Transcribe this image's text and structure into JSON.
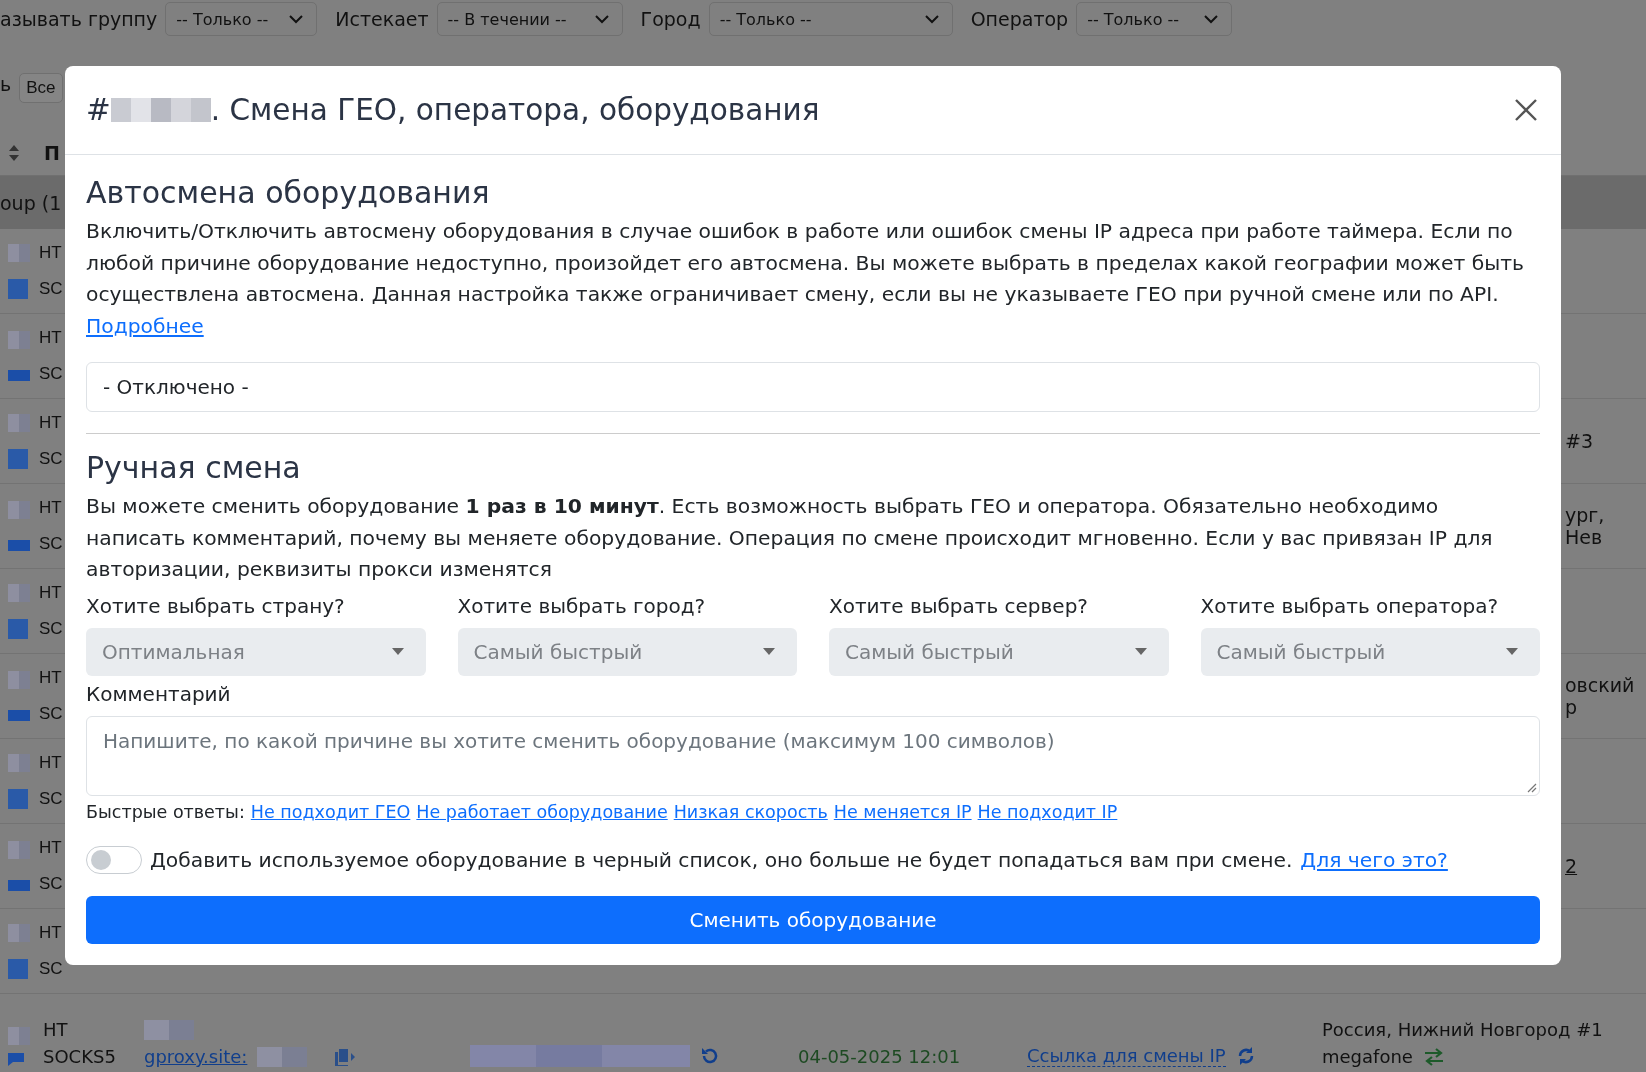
{
  "filters": [
    {
      "label": "азывать группу",
      "value": "-- Только --"
    },
    {
      "label": "Истекает",
      "value": "-- В течении --"
    },
    {
      "label": "Город",
      "value": "-- Только --"
    },
    {
      "label": "Оператор",
      "value": "-- Только --"
    }
  ],
  "toolbar": {
    "cut_text": "ь",
    "button": "Все"
  },
  "table": {
    "header": "П",
    "group_row": "oup (1",
    "rows": [
      {
        "column_1": "HT",
        "column_2": "SC",
        "kind": "square"
      },
      {
        "column_1": "HT",
        "column_2": "SC",
        "kind": "bar"
      },
      {
        "column_1": "HT",
        "column_2": "SC",
        "kind": "square",
        "right": "#3"
      },
      {
        "column_1": "HT",
        "column_2": "SC",
        "kind": "bar",
        "right": "ург, Нев"
      },
      {
        "column_1": "HT",
        "column_2": "SC",
        "kind": "square"
      },
      {
        "column_1": "HT",
        "column_2": "SC",
        "kind": "bar",
        "right": "овский р"
      },
      {
        "column_1": "HT",
        "column_2": "SC",
        "kind": "square"
      },
      {
        "column_1": "HT",
        "column_2": "SC",
        "kind": "bar",
        "right_link": "2"
      },
      {
        "column_1": "HT",
        "column_2": "SC",
        "kind": "square"
      }
    ],
    "last_row": {
      "column_1": "HT",
      "protocol": "SOCKS5",
      "host": "gproxy.site:",
      "date": "04-05-2025 12:01",
      "link": "Ссылка для смены IP",
      "geo": "Россия, Нижний Новгород #1",
      "operator": "megafone"
    }
  },
  "modal": {
    "title_prefix": "#",
    "title": ". Смена ГЕО, оператора, оборудования",
    "auto": {
      "heading": "Автосмена оборудования",
      "text": "Включить/Отключить автосмену оборудования в случае ошибок в работе или ошибок смены IP адреса при работе таймера. Если по любой причине оборудование недоступно, произойдет его автосмена. Вы можете выбрать в пределах какой географии может быть осуществлена автосмена. Данная настройка также ограничивает смену, если вы не указываете ГЕО при ручной смене или по API.",
      "link": "Подробнее",
      "select": "- Отключено -"
    },
    "manual": {
      "heading": "Ручная смена",
      "text": "Вы можете сменить оборудование **1 раз в 10 минут**. Есть возможность выбрать ГЕО и оператора. Обязательно необходимо написать комментарий, почему вы меняете оборудование. Операция по смене происходит мгновенно. Если у вас привязан IP для авторизации, реквизиты прокси изменятся",
      "selects": [
        {
          "label": "Хотите выбрать страну?",
          "value": "Оптимальная"
        },
        {
          "label": "Хотите выбрать город?",
          "value": "Самый быстрый"
        },
        {
          "label": "Хотите выбрать сервер?",
          "value": "Самый быстрый"
        },
        {
          "label": "Хотите выбрать оператора?",
          "value": "Самый быстрый"
        }
      ],
      "comment_label": "Комментарий",
      "comment_placeholder": "Напишите, по какой причине вы хотите сменить оборудование (максимум 100 символов)",
      "quick_label": "Быстрые ответы:",
      "quick_answers": [
        "Не подходит ГЕО",
        "Не работает оборудование",
        "Низкая скорость",
        "Не меняется IP",
        "Не подходит IP"
      ],
      "blacklist": {
        "on": false,
        "text": "Добавить используемое оборудование в черный список, оно больше не будет попадаться вам при смене.",
        "link": "Для чего это?"
      },
      "submit": "Сменить оборудование"
    }
  }
}
